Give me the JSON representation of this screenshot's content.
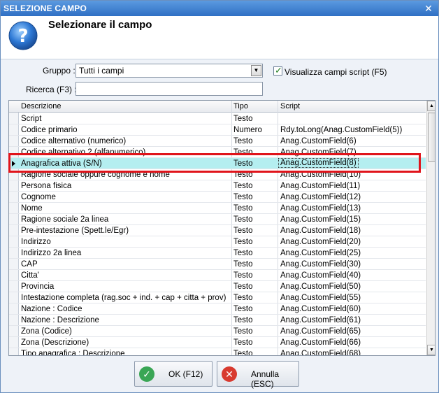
{
  "window": {
    "title": "SELEZIONE CAMPO",
    "close_glyph": "✕"
  },
  "header": {
    "heading": "Selezionare il campo",
    "icon": "question-icon"
  },
  "filters": {
    "gruppo_label": "Gruppo :",
    "gruppo_value": "Tutti i campi",
    "show_scripts_label": "Visualizza campi script (F5)",
    "show_scripts_checked": true,
    "ricerca_label": "Ricerca (F3) :",
    "ricerca_value": ""
  },
  "grid": {
    "columns": [
      "Descrizione",
      "Tipo",
      "Script"
    ],
    "rows": [
      [
        "Script",
        "Testo",
        ""
      ],
      [
        "Codice primario",
        "Numero",
        "Rdy.toLong(Anag.CustomField(5))"
      ],
      [
        "Codice alternativo (numerico)",
        "Testo",
        "Anag.CustomField(6)"
      ],
      [
        "Codice alternativo 2 (alfanumerico)",
        "Testo",
        "Anag.CustomField(7)"
      ],
      [
        "Anagrafica attiva (S/N)",
        "Testo",
        "Anag.CustomField(8)"
      ],
      [
        "Ragione sociale oppure cognome e nome",
        "Testo",
        "Anag.CustomField(10)"
      ],
      [
        "Persona fisica",
        "Testo",
        "Anag.CustomField(11)"
      ],
      [
        "Cognome",
        "Testo",
        "Anag.CustomField(12)"
      ],
      [
        "Nome",
        "Testo",
        "Anag.CustomField(13)"
      ],
      [
        "Ragione sociale 2a linea",
        "Testo",
        "Anag.CustomField(15)"
      ],
      [
        "Pre-intestazione (Spett.le/Egr)",
        "Testo",
        "Anag.CustomField(18)"
      ],
      [
        "Indirizzo",
        "Testo",
        "Anag.CustomField(20)"
      ],
      [
        "Indirizzo 2a linea",
        "Testo",
        "Anag.CustomField(25)"
      ],
      [
        "CAP",
        "Testo",
        "Anag.CustomField(30)"
      ],
      [
        "Citta'",
        "Testo",
        "Anag.CustomField(40)"
      ],
      [
        "Provincia",
        "Testo",
        "Anag.CustomField(50)"
      ],
      [
        "Intestazione completa (rag.soc + ind. + cap + citta + prov)",
        "Testo",
        "Anag.CustomField(55)"
      ],
      [
        "Nazione : Codice",
        "Testo",
        "Anag.CustomField(60)"
      ],
      [
        "Nazione : Descrizione",
        "Testo",
        "Anag.CustomField(61)"
      ],
      [
        "Zona (Codice)",
        "Testo",
        "Anag.CustomField(65)"
      ],
      [
        "Zona (Descrizione)",
        "Testo",
        "Anag.CustomField(66)"
      ],
      [
        "Tipo anagrafica : Descrizione",
        "Testo",
        "Anag.CustomField(68)"
      ]
    ],
    "selected_row": 4
  },
  "buttons": {
    "ok": {
      "label": "OK (F12)",
      "icon": "check-icon",
      "glyph": "✓",
      "color": "#3aa655"
    },
    "cancel": {
      "label": "Annulla (ESC)",
      "icon": "cancel-icon",
      "glyph": "✕",
      "color": "#d83a2f"
    }
  },
  "colors": {
    "titlebar": "#3a7fd0",
    "selected_row": "#b4eef0",
    "highlight_box": "#e0141b"
  }
}
